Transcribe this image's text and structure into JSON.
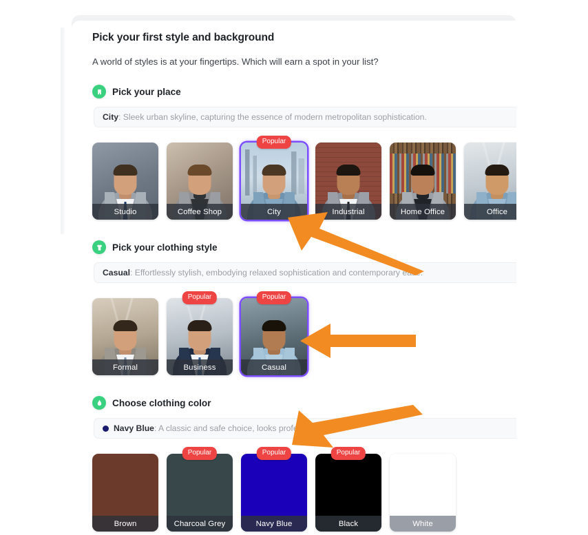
{
  "page": {
    "title": "Pick your first style and background",
    "subtitle": "A world of styles is at your fingertips. Which will earn a spot in your list?"
  },
  "colors": {
    "accent_selected": "#7c4dff",
    "badge_popular": "#ef4444",
    "step_badge": "#39d17f",
    "arrow": "#f28b22"
  },
  "sections": [
    {
      "id": "place",
      "icon": "building-icon",
      "title": "Pick your place",
      "description": {
        "name": "City",
        "text": ": Sleek urban skyline, capturing the essence of modern metropolitan sophistication."
      },
      "options": [
        {
          "label": "Studio",
          "popular": false,
          "selected": false
        },
        {
          "label": "Coffee Shop",
          "popular": false,
          "selected": false
        },
        {
          "label": "City",
          "popular": true,
          "selected": true
        },
        {
          "label": "Industrial",
          "popular": false,
          "selected": false
        },
        {
          "label": "Home Office",
          "popular": false,
          "selected": false
        },
        {
          "label": "Office",
          "popular": false,
          "selected": false
        }
      ]
    },
    {
      "id": "clothing-style",
      "icon": "shirt-icon",
      "title": "Pick your clothing style",
      "description": {
        "name": "Casual",
        "text": ": Effortlessly stylish, embodying relaxed sophistication and contemporary ease."
      },
      "options": [
        {
          "label": "Formal",
          "popular": false,
          "selected": false
        },
        {
          "label": "Business",
          "popular": true,
          "selected": false
        },
        {
          "label": "Casual",
          "popular": true,
          "selected": true
        }
      ]
    },
    {
      "id": "clothing-color",
      "icon": "color-drop-icon",
      "title": "Choose clothing color",
      "description": {
        "name": "Navy Blue",
        "text": ": A classic and safe choice, looks professional.",
        "dot_color": "#1a1a6e"
      },
      "options": [
        {
          "label": "Brown",
          "popular": false,
          "selected": false,
          "swatch": "#6b3a2a",
          "label_style": "dark"
        },
        {
          "label": "Charcoal Grey",
          "popular": true,
          "selected": false,
          "swatch": "#37474a",
          "label_style": "dark"
        },
        {
          "label": "Navy Blue",
          "popular": true,
          "selected": true,
          "swatch": "#1a00b8",
          "label_style": "dark"
        },
        {
          "label": "Black",
          "popular": false,
          "selected": false,
          "swatch": "#000000",
          "label_style": "dark"
        },
        {
          "label": "White",
          "popular": false,
          "selected": false,
          "swatch": "#ffffff",
          "label_style": "light"
        }
      ]
    }
  ],
  "badges": {
    "popular_label": "Popular"
  },
  "annotations": [
    {
      "name": "arrow-to-city-card",
      "direction": "up-left"
    },
    {
      "name": "arrow-to-casual-card",
      "direction": "left"
    },
    {
      "name": "arrow-to-navy-blue-card",
      "direction": "down-left"
    }
  ]
}
